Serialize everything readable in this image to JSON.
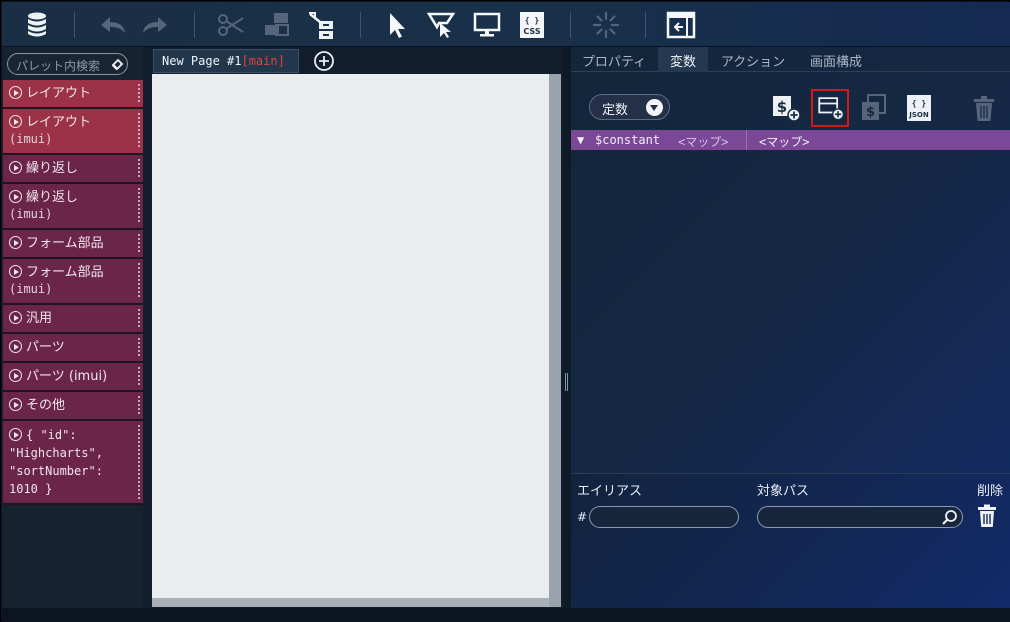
{
  "toolbar": {
    "icons": [
      "database-icon",
      "undo-icon",
      "redo-icon",
      "cut-icon",
      "copy-icon",
      "paste-icon",
      "select-arrow-icon",
      "select-area-icon",
      "preview-icon",
      "css-icon",
      "spinner-icon",
      "panel-toggle-icon"
    ],
    "css_label": "CSS"
  },
  "palette": {
    "search_placeholder": "パレット内検索",
    "items": [
      {
        "label": "レイアウト",
        "sub": ""
      },
      {
        "label": "レイアウト",
        "sub": "(imui)"
      },
      {
        "label": "繰り返し",
        "sub": ""
      },
      {
        "label": "繰り返し",
        "sub": "(imui)"
      },
      {
        "label": "フォーム部品",
        "sub": ""
      },
      {
        "label": "フォーム部品",
        "sub": "(imui)"
      },
      {
        "label": "汎用",
        "sub": ""
      },
      {
        "label": "パーツ",
        "sub": ""
      },
      {
        "label": "パーツ (imui)",
        "sub": ""
      },
      {
        "label": "その他",
        "sub": ""
      }
    ],
    "code_item": [
      "{ \"id\":",
      "\"Highcharts\",",
      "\"sortNumber\":",
      "1010 }"
    ]
  },
  "editor": {
    "page_tab": "New Page #1",
    "branch": "[main]"
  },
  "right_panel": {
    "tabs": [
      "プロパティ",
      "変数",
      "アクション",
      "画面構成"
    ],
    "active_tab": "変数",
    "constant_type": "定数",
    "constant_row": {
      "name": "$constant",
      "type": "<マップ>",
      "value": "<マップ>"
    },
    "alias_headers": {
      "alias": "エイリアス",
      "target_path": "対象パス",
      "delete": "削除"
    },
    "hash": "#",
    "json_label": "JSON"
  },
  "colors": {
    "palette_item": "#6b2549",
    "palette_item_active": "#9b3248",
    "constant_row": "#7a4896",
    "highlight": "#d01a1a"
  }
}
